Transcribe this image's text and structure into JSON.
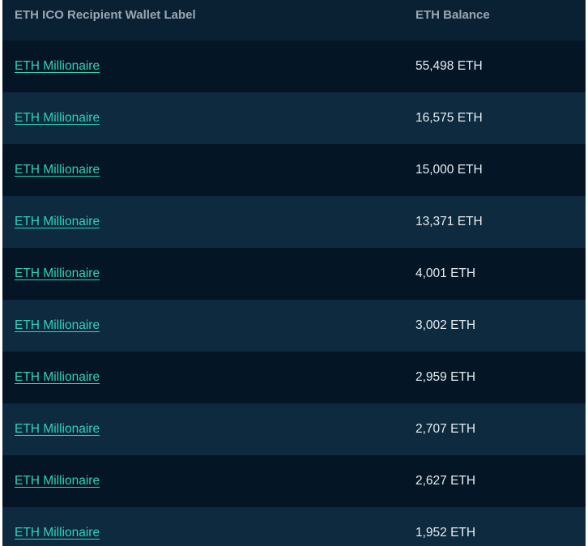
{
  "table": {
    "columns": [
      "ETH ICO Recipient Wallet Label",
      "ETH Balance"
    ],
    "rows": [
      {
        "label": "ETH Millionaire",
        "balance": "55,498 ETH"
      },
      {
        "label": "ETH Millionaire",
        "balance": "16,575 ETH"
      },
      {
        "label": "ETH Millionaire",
        "balance": "15,000 ETH"
      },
      {
        "label": "ETH Millionaire",
        "balance": "13,371 ETH"
      },
      {
        "label": "ETH Millionaire",
        "balance": "4,001 ETH"
      },
      {
        "label": "ETH Millionaire",
        "balance": "3,002 ETH"
      },
      {
        "label": "ETH Millionaire",
        "balance": "2,959 ETH"
      },
      {
        "label": "ETH Millionaire",
        "balance": "2,707 ETH"
      },
      {
        "label": "ETH Millionaire",
        "balance": "2,627 ETH"
      },
      {
        "label": "ETH Millionaire",
        "balance": "1,952 ETH"
      }
    ]
  },
  "colors": {
    "background": "#06192a",
    "header_text": "#9aa6b2",
    "link": "#2fd3b8",
    "value_text": "#e7edf2"
  }
}
